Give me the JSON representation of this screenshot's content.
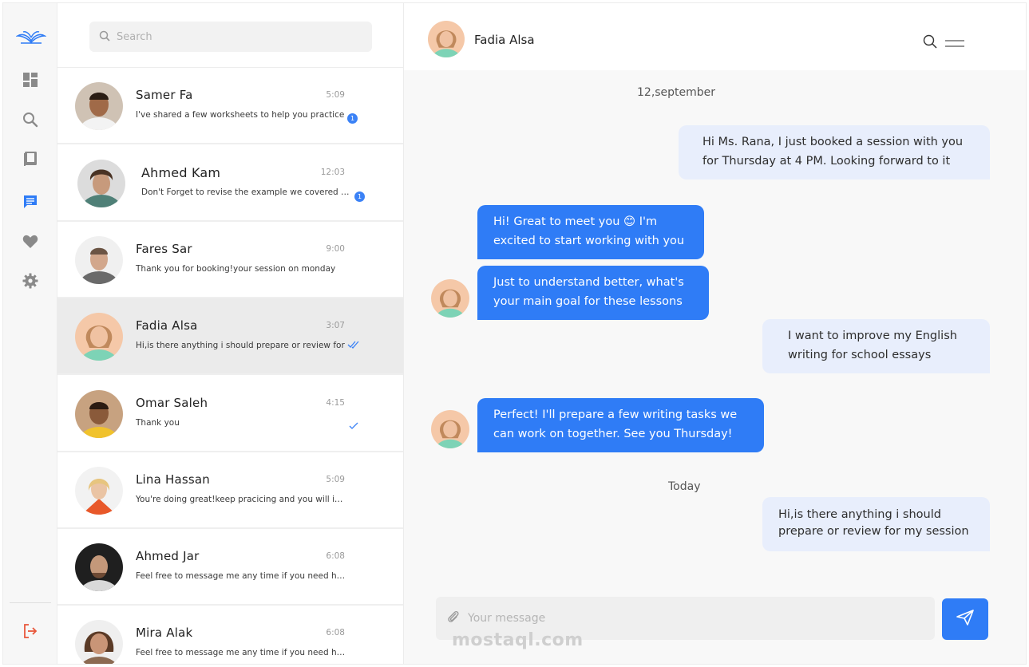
{
  "colors": {
    "accent": "#2f7cf6",
    "outgoing_bubble": "#e8eefc",
    "active_row": "#ebebeb",
    "logout": "#e8573b"
  },
  "rail": {
    "items": [
      {
        "icon": "logo-icon"
      },
      {
        "icon": "dashboard-icon"
      },
      {
        "icon": "search-icon"
      },
      {
        "icon": "book-icon"
      },
      {
        "icon": "chat-icon",
        "active": true
      },
      {
        "icon": "heart-icon"
      },
      {
        "icon": "gear-icon"
      },
      {
        "icon": "logout-icon"
      }
    ]
  },
  "search": {
    "placeholder": "Search"
  },
  "conversations": [
    {
      "name": "Samer Fa",
      "time": "5:09",
      "preview": "I've shared a few worksheets to help you practice",
      "badge": "1"
    },
    {
      "name": "Ahmed Kam",
      "time": "12:03",
      "preview": "Don't Forget to revise the example we covered today",
      "badge": "1"
    },
    {
      "name": "Fares Sar",
      "time": "9:00",
      "preview": "Thank you for booking!your session on monday"
    },
    {
      "name": "Fadia Alsa",
      "time": "3:07",
      "preview": "Hi,is there anything i should prepare or review for",
      "status": "read"
    },
    {
      "name": "Omar Saleh",
      "time": "4:15",
      "preview": "Thank you",
      "status": "sent"
    },
    {
      "name": "Lina Hassan",
      "time": "5:09",
      "preview": "You're doing great!keep pracicing and you will improve"
    },
    {
      "name": "Ahmed Jar",
      "time": "6:08",
      "preview": "Feel free to message me any time if you need help"
    },
    {
      "name": "Mira Alak",
      "time": "6:08",
      "preview": "Feel free to message me any time if you need help"
    }
  ],
  "chat": {
    "contact_name": "Fadia Alsa",
    "date_1": "12,september",
    "date_2": "Today",
    "messages": [
      {
        "dir": "out",
        "lines": [
          "Hi Ms. Rana, I just booked a session with you",
          "for Thursday at 4 PM. Looking forward to it"
        ]
      },
      {
        "dir": "in",
        "lines": [
          "Hi! Great to meet you 😊 I'm",
          "excited to start working with you"
        ]
      },
      {
        "dir": "in",
        "lines": [
          "Just to understand better, what's",
          "your main goal for these lessons"
        ]
      },
      {
        "dir": "out",
        "lines": [
          "I want to improve my English",
          "writing for school essays"
        ]
      },
      {
        "dir": "in",
        "lines": [
          "Perfect! I'll prepare a few writing tasks we",
          "can work on together. See you Thursday!"
        ]
      },
      {
        "dir": "out",
        "lines": [
          "Hi,is there anything i should",
          "prepare or review for my session"
        ]
      }
    ],
    "composer_placeholder": "Your message",
    "watermark": "mostaql.com"
  }
}
